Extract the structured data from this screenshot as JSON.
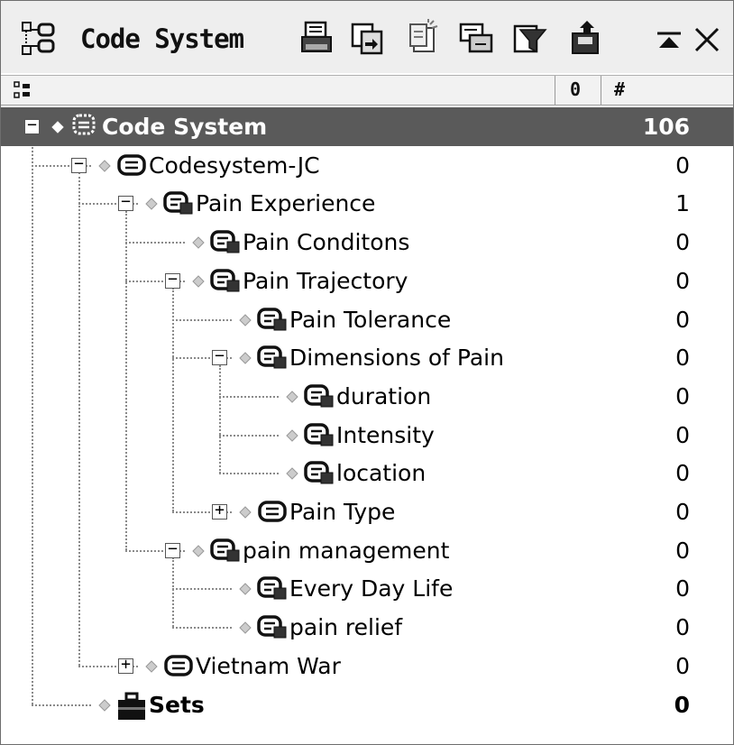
{
  "title": "Code System",
  "toolbar": {
    "icons": [
      "print-icon",
      "copy-icon",
      "paste-icon",
      "merge-icon",
      "filter-icon",
      "export-icon"
    ]
  },
  "window_buttons": {
    "minimize": "▲",
    "close": "✕"
  },
  "columns": {
    "tree_icon": "tree-icon",
    "col2": "0",
    "col3": "#"
  },
  "tree": [
    {
      "label": "Code System",
      "count": "106",
      "level": 0,
      "expander": "−",
      "icon": "code-system-icon",
      "selected": true
    },
    {
      "label": "Codesystem-JC",
      "count": "0",
      "level": 1,
      "expander": "−",
      "icon": "code-group-icon"
    },
    {
      "label": "Pain Experience",
      "count": "1",
      "level": 2,
      "expander": "−",
      "icon": "code-icon"
    },
    {
      "label": "Pain Conditons",
      "count": "0",
      "level": 3,
      "expander": "",
      "icon": "code-icon"
    },
    {
      "label": "Pain Trajectory",
      "count": "0",
      "level": 3,
      "expander": "−",
      "icon": "code-icon"
    },
    {
      "label": "Pain Tolerance",
      "count": "0",
      "level": 4,
      "expander": "",
      "icon": "code-icon"
    },
    {
      "label": "Dimensions of Pain",
      "count": "0",
      "level": 4,
      "expander": "−",
      "icon": "code-icon"
    },
    {
      "label": "duration",
      "count": "0",
      "level": 5,
      "expander": "",
      "icon": "code-icon"
    },
    {
      "label": "Intensity",
      "count": "0",
      "level": 5,
      "expander": "",
      "icon": "code-icon"
    },
    {
      "label": "location",
      "count": "0",
      "level": 5,
      "expander": "",
      "icon": "code-icon"
    },
    {
      "label": "Pain Type",
      "count": "0",
      "level": 4,
      "expander": "+",
      "icon": "code-group-icon"
    },
    {
      "label": "pain management",
      "count": "0",
      "level": 3,
      "expander": "−",
      "icon": "code-icon"
    },
    {
      "label": "Every Day Life",
      "count": "0",
      "level": 4,
      "expander": "",
      "icon": "code-icon"
    },
    {
      "label": "pain relief",
      "count": "0",
      "level": 4,
      "expander": "",
      "icon": "code-icon"
    },
    {
      "label": "Vietnam War",
      "count": "0",
      "level": 2,
      "expander": "+",
      "icon": "code-group-icon"
    },
    {
      "label": "Sets",
      "count": "0",
      "level": 1,
      "expander": "",
      "icon": "sets-icon",
      "bold": true
    }
  ]
}
